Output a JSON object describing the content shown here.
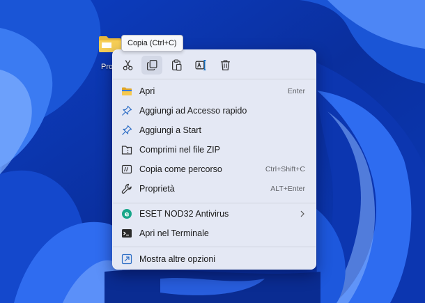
{
  "desktop": {
    "icon_label": "Pro"
  },
  "tooltip": {
    "text": "Copia (Ctrl+C)"
  },
  "toolbar": {
    "items": [
      {
        "name": "Taglia",
        "icon": "scissors-icon"
      },
      {
        "name": "Copia",
        "icon": "copy-icon"
      },
      {
        "name": "Incolla",
        "icon": "paste-icon"
      },
      {
        "name": "Rinomina",
        "icon": "rename-icon"
      },
      {
        "name": "Elimina",
        "icon": "trash-icon"
      }
    ]
  },
  "menu": {
    "items": [
      {
        "label": "Apri",
        "shortcut": "Enter",
        "icon": "folder-icon"
      },
      {
        "label": "Aggiungi ad Accesso rapido",
        "shortcut": "",
        "icon": "pin-icon"
      },
      {
        "label": "Aggiungi a Start",
        "shortcut": "",
        "icon": "pin-icon"
      },
      {
        "label": "Comprimi nel file ZIP",
        "shortcut": "",
        "icon": "zip-icon"
      },
      {
        "label": "Copia come percorso",
        "shortcut": "Ctrl+Shift+C",
        "icon": "path-icon"
      },
      {
        "label": "Proprietà",
        "shortcut": "ALT+Enter",
        "icon": "wrench-icon"
      },
      {
        "label": "ESET NOD32 Antivirus",
        "shortcut": "",
        "icon": "eset-icon",
        "submenu": true
      },
      {
        "label": "Apri nel Terminale",
        "shortcut": "",
        "icon": "terminal-icon"
      },
      {
        "label": "Mostra altre opzioni",
        "shortcut": "",
        "icon": "more-options-icon"
      }
    ]
  },
  "colors": {
    "accent": "#0067c0",
    "eset_green": "#17a689",
    "menu_bg": "#e4e8f4"
  }
}
